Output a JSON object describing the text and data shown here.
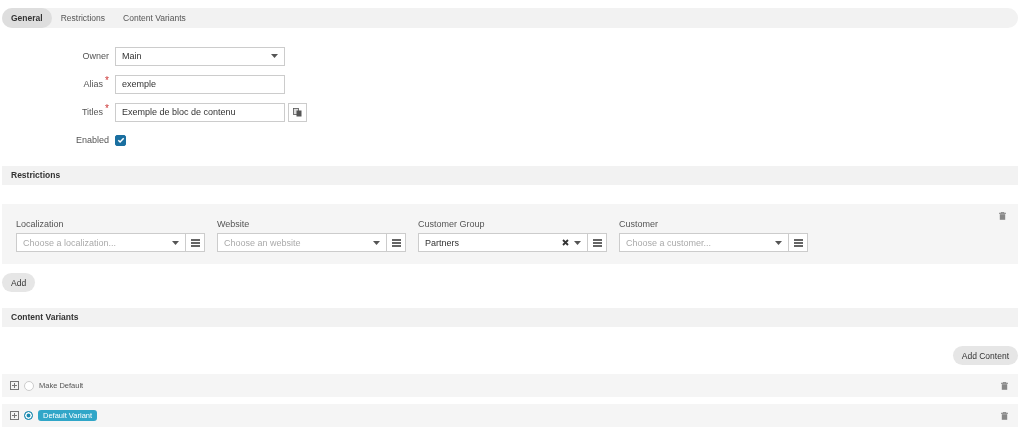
{
  "tabs": [
    {
      "label": "General",
      "selected": true
    },
    {
      "label": "Restrictions",
      "selected": false
    },
    {
      "label": "Content Variants",
      "selected": false
    }
  ],
  "general": {
    "fields": [
      {
        "kind": "select",
        "label": "Owner",
        "value": "Main"
      },
      {
        "kind": "text",
        "label": "Alias",
        "required_mark": "*",
        "value": "exemple"
      },
      {
        "kind": "translatable",
        "label": "Titles",
        "required_mark": "*",
        "value": "Exemple de bloc de contenu"
      },
      {
        "kind": "checkbox",
        "label": "Enabled",
        "checked": true
      }
    ]
  },
  "restrictions": {
    "title": "Restrictions",
    "filters": [
      {
        "label": "Localization",
        "placeholder": "Choose a localization..."
      },
      {
        "label": "Website",
        "placeholder": "Choose an website"
      },
      {
        "label": "Customer Group",
        "value": "Partners"
      },
      {
        "label": "Customer",
        "placeholder": "Choose a customer..."
      }
    ],
    "add_button": "Add"
  },
  "content_variants": {
    "title": "Content Variants",
    "add_button": "Add Content",
    "variants": [
      {
        "label": "Make Default",
        "selected": false
      },
      {
        "label": "Default Variant",
        "selected": true
      }
    ]
  }
}
